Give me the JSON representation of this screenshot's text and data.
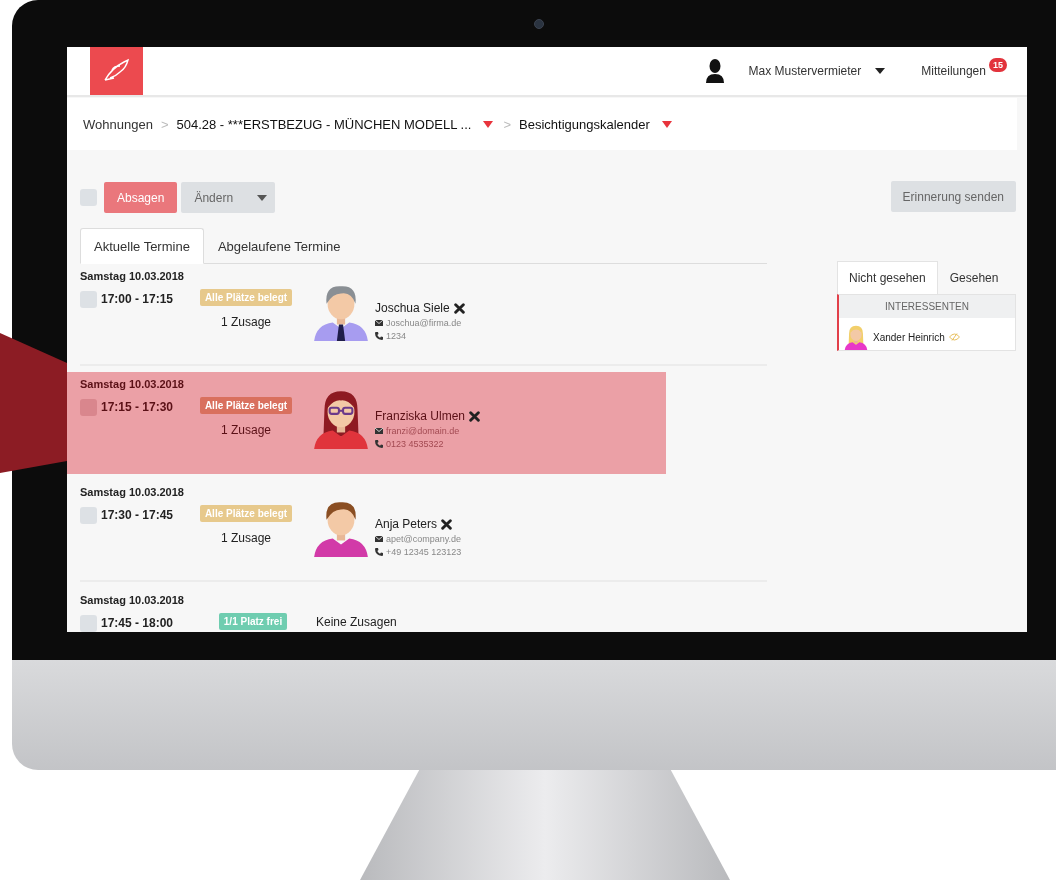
{
  "header": {
    "user_name": "Max Mustervermieter",
    "notifications_label": "Mitteilungen",
    "notifications_count": "15"
  },
  "breadcrumb": [
    {
      "label": "Wohnungen",
      "dropdown": false
    },
    {
      "separator": ">",
      "label": "504.28 - ***ERSTBEZUG - MÜNCHEN MODELL ...",
      "dropdown": true
    },
    {
      "separator": ">",
      "label": "Besichtigungskalender",
      "dropdown": true
    }
  ],
  "toolbar": {
    "select_all_checked": false,
    "buttons": [
      {
        "label": "Absagen",
        "kind": "danger"
      },
      {
        "label": "Ändern",
        "kind": "dropdown"
      }
    ],
    "reminder_button": "Erinnerung senden"
  },
  "tabs": [
    {
      "label": "Aktuelle Termine",
      "selected": true
    },
    {
      "label": "Abgelaufene Termine",
      "selected": false
    }
  ],
  "appointments": [
    {
      "date": "Samstag 10.03.2018",
      "time": "17:00 - 17:15",
      "checked": false,
      "highlighted": false,
      "status": {
        "label": "Alle Plätze belegt",
        "kind": "full"
      },
      "summary": "1 Zusage",
      "attendee": {
        "avatar": {
          "kind": "man"
        },
        "name": "Joschua Siele",
        "email": "Joschua@firma.de",
        "phone": "1234"
      }
    },
    {
      "date": "Samstag 10.03.2018",
      "time": "17:15 - 17:30",
      "checked": false,
      "highlighted": true,
      "status": {
        "label": "Alle Plätze belegt",
        "kind": "full"
      },
      "summary": "1 Zusage",
      "attendee": {
        "avatar": {
          "kind": "woman-glasses"
        },
        "name": "Franziska Ulmen",
        "email": "franzi@domain.de",
        "phone": "0123 4535322"
      }
    },
    {
      "date": "Samstag 10.03.2018",
      "time": "17:30 - 17:45",
      "checked": false,
      "highlighted": false,
      "status": {
        "label": "Alle Plätze belegt",
        "kind": "full"
      },
      "summary": "1 Zusage",
      "attendee": {
        "avatar": {
          "kind": "woman"
        },
        "name": "Anja Peters",
        "email": "apet@company.de",
        "phone": "+49 12345 123123"
      }
    },
    {
      "date": "Samstag 10.03.2018",
      "time": "17:45 - 18:00",
      "checked": false,
      "highlighted": false,
      "status": {
        "label": "1/1 Platz frei",
        "kind": "free"
      },
      "summary": "Keine Zusagen"
    }
  ],
  "side_panel": {
    "tabs": [
      {
        "label": "Nicht gesehen",
        "selected": true
      },
      {
        "label": "Gesehen",
        "selected": false
      }
    ],
    "header": "INTERESSENTEN",
    "items": [
      {
        "name": "Xander Heinrich",
        "avatar": {
          "kind": "woman-blonde"
        }
      }
    ]
  }
}
